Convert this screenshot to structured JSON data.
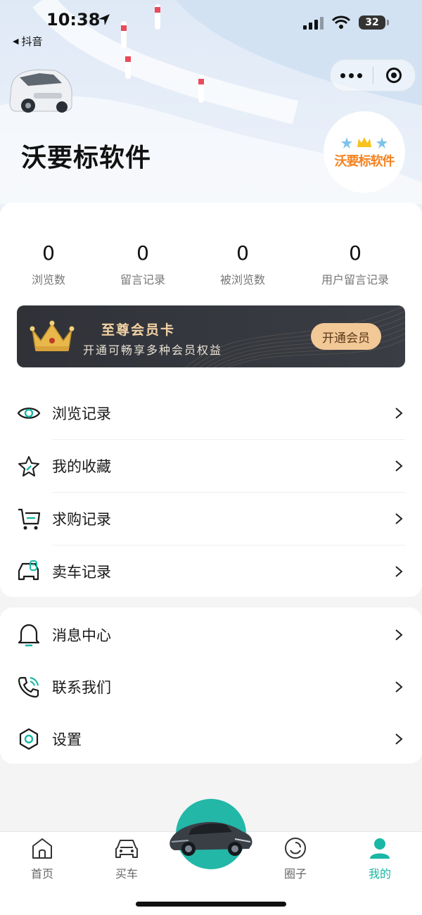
{
  "status_bar": {
    "time": "10:38",
    "back_app": "抖音",
    "battery": "32"
  },
  "header": {
    "title": "沃要标软件",
    "logo_text": "沃要标软件"
  },
  "stats": [
    {
      "value": "0",
      "label": "浏览数"
    },
    {
      "value": "0",
      "label": "留言记录"
    },
    {
      "value": "0",
      "label": "被浏览数"
    },
    {
      "value": "0",
      "label": "用户留言记录"
    }
  ],
  "vip_card": {
    "title": "至尊会员卡",
    "subtitle": "开通可畅享多种会员权益",
    "button": "开通会员",
    "accent_color": "#f2c896"
  },
  "menu_group1": [
    {
      "label": "浏览记录",
      "icon": "eye-icon"
    },
    {
      "label": "我的收藏",
      "icon": "star-icon"
    },
    {
      "label": "求购记录",
      "icon": "cart-icon"
    },
    {
      "label": "卖车记录",
      "icon": "car-tag-icon"
    }
  ],
  "menu_group2": [
    {
      "label": "消息中心",
      "icon": "bell-icon"
    },
    {
      "label": "联系我们",
      "icon": "phone-icon"
    },
    {
      "label": "设置",
      "icon": "hexagon-settings-icon"
    }
  ],
  "tabbar": {
    "items": [
      {
        "label": "首页",
        "icon": "home-icon"
      },
      {
        "label": "买车",
        "icon": "car-front-icon"
      },
      {
        "label": "圈子",
        "icon": "circle-face-icon"
      },
      {
        "label": "我的",
        "icon": "user-icon"
      }
    ],
    "active_index": 3,
    "active_color": "#1ab7a4"
  }
}
